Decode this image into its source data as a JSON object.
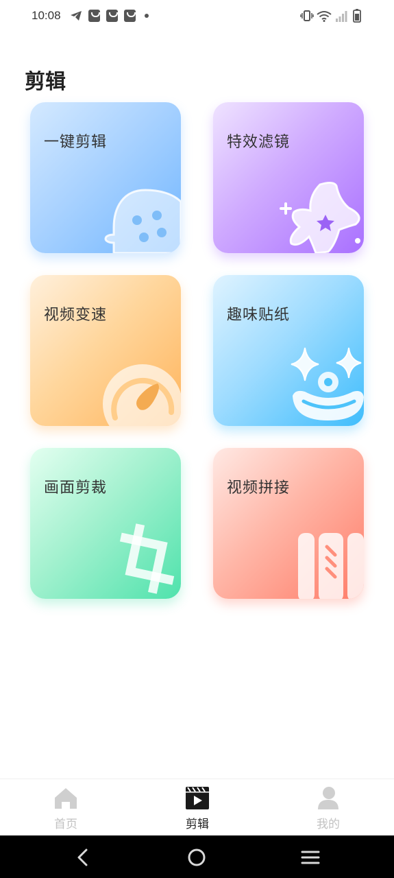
{
  "status_bar": {
    "time": "10:08",
    "left_icons": [
      "telegram-icon",
      "shopping-bag-icon",
      "shopping-bag-icon",
      "shopping-bag-icon",
      "dot-icon"
    ],
    "right_icons": [
      "vibrate-icon",
      "wifi-icon",
      "signal-icon",
      "battery-icon"
    ]
  },
  "page": {
    "title": "剪辑"
  },
  "cards": [
    {
      "label": "一键剪辑",
      "icon": "film-reel-icon",
      "color": "#71b6ff"
    },
    {
      "label": "特效滤镜",
      "icon": "magic-star-icon",
      "color": "#a970ff"
    },
    {
      "label": "视频变速",
      "icon": "speedometer-icon",
      "color": "#ffb45c"
    },
    {
      "label": "趣味贴纸",
      "icon": "sticker-face-icon",
      "color": "#3fbdfc"
    },
    {
      "label": "画面剪裁",
      "icon": "crop-icon",
      "color": "#4fe2ac"
    },
    {
      "label": "视频拼接",
      "icon": "video-splice-icon",
      "color": "#ff7c68"
    }
  ],
  "bottom_nav": {
    "tabs": [
      {
        "label": "首页",
        "icon": "home-icon",
        "active": false
      },
      {
        "label": "剪辑",
        "icon": "video-clip-icon",
        "active": true
      },
      {
        "label": "我的",
        "icon": "user-icon",
        "active": false
      }
    ]
  },
  "system_nav": [
    "back-icon",
    "home-circle-icon",
    "menu-icon"
  ]
}
